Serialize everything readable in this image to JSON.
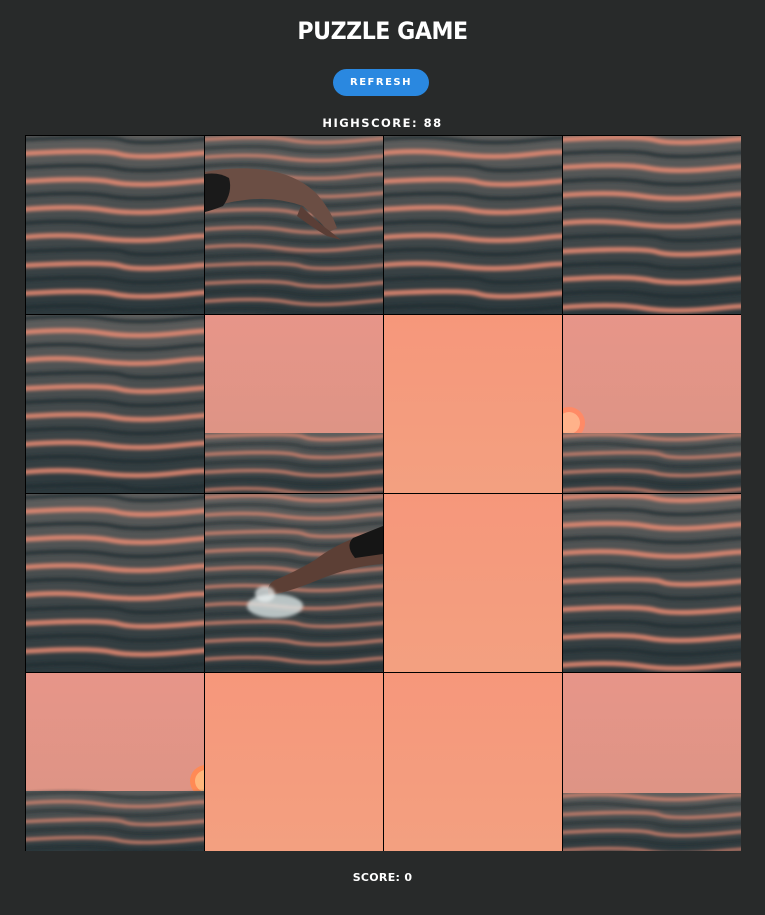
{
  "header": {
    "title": "PUZZLE GAME",
    "refresh_label": "REFRESH",
    "highscore_label": "HIGHSCORE: 88"
  },
  "footer": {
    "score_label": "SCORE: 0"
  },
  "colors": {
    "background": "#282a2a",
    "accent": "#2a88e0",
    "sky": "#f79a7e",
    "water": "#2f3b40"
  },
  "board": {
    "rows": 4,
    "cols": 4,
    "tiles": [
      {
        "image_piece": "water-ripples"
      },
      {
        "image_piece": "diver-upper-body"
      },
      {
        "image_piece": "water-ripples"
      },
      {
        "image_piece": "water-ripples"
      },
      {
        "image_piece": "water-ripples"
      },
      {
        "image_piece": "horizon"
      },
      {
        "image_piece": "sky"
      },
      {
        "image_piece": "horizon-sun-left"
      },
      {
        "image_piece": "water-ripples"
      },
      {
        "image_piece": "diver-legs-splash"
      },
      {
        "image_piece": "sky"
      },
      {
        "image_piece": "water-ripples"
      },
      {
        "image_piece": "horizon-sun-right"
      },
      {
        "image_piece": "sky"
      },
      {
        "image_piece": "sky"
      },
      {
        "image_piece": "horizon-low"
      }
    ]
  }
}
